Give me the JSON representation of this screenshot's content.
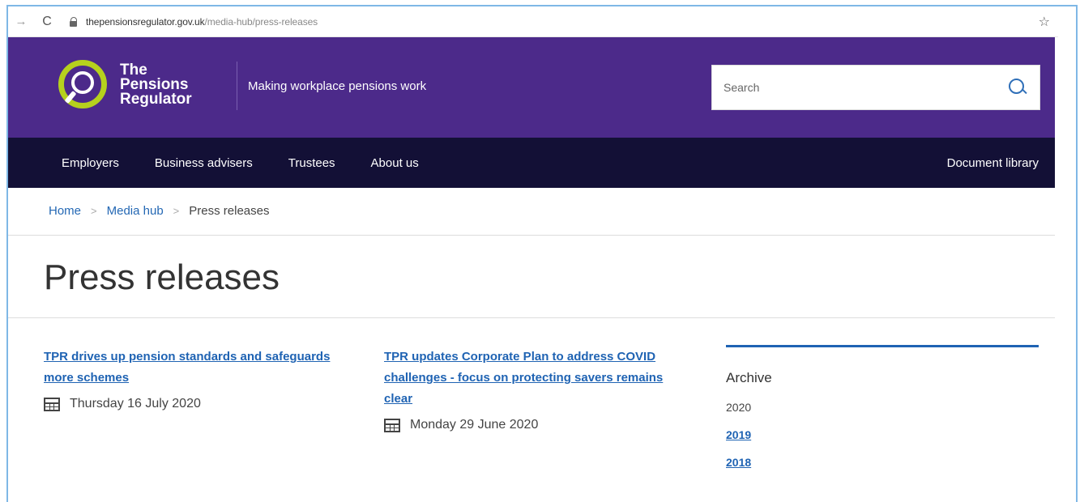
{
  "browser": {
    "url_domain": "thepensionsregulator.gov.uk",
    "url_path": "/media-hub/press-releases"
  },
  "header": {
    "brand_line1": "The",
    "brand_line2": "Pensions",
    "brand_line3": "Regulator",
    "tagline": "Making workplace pensions work",
    "search_placeholder": "Search"
  },
  "nav": {
    "items": [
      "Employers",
      "Business advisers",
      "Trustees",
      "About us"
    ],
    "document_library": "Document library"
  },
  "breadcrumb": {
    "home": "Home",
    "media_hub": "Media hub",
    "current": "Press releases",
    "separator": ">"
  },
  "page_title": "Press releases",
  "articles": [
    {
      "title": "TPR drives up pension standards and safeguards more schemes",
      "date": "Thursday 16 July 2020"
    },
    {
      "title": "TPR updates Corporate Plan to address COVID challenges - focus on protecting savers remains clear",
      "date": "Monday 29 June 2020"
    }
  ],
  "archive": {
    "heading": "Archive",
    "current_year": "2020",
    "years": [
      "2019",
      "2018"
    ]
  },
  "colors": {
    "header_bg": "#4c2a8a",
    "nav_bg": "#131036",
    "logo_accent": "#b6d11d",
    "link": "#1f63b3"
  }
}
